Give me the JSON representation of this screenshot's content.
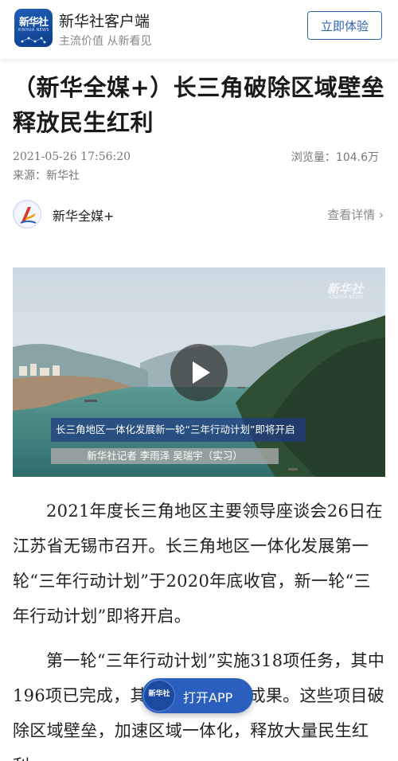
{
  "app_bar": {
    "logo_text": "新华社",
    "logo_sub": "XINHUA NEWS",
    "app_name": "新华社客户端",
    "slogan": "主流价值 从新看见",
    "cta_label": "立即体验"
  },
  "article": {
    "title": "（新华全媒+）长三角破除区域壁垒 释放民生红利",
    "datetime": "2021-05-26 17:56:20",
    "views": "浏览量：104.6万",
    "source": "来源：新华社"
  },
  "channel": {
    "name": "新华全媒+",
    "more_label": "查看详情 ›"
  },
  "video": {
    "watermark": "新华社",
    "watermark_sub": "XINHUA NEWS",
    "caption_title": "长三角地区一体化发展新一轮“三年行动计划”即将开启",
    "caption_credit": "新华社记者 李雨泽 吴瑞宇（实习）"
  },
  "body": {
    "paragraphs": [
      "2021年度长三角地区主要领导座谈会26日在江苏省无锡市召开。长三角地区一体化发展第一轮“三年行动计划”于2020年底收官，新一轮“三年行动计划”即将开启。",
      "第一轮“三年行动计划”实施318项任务，其中196项已完成，其余取得阶段性成果。这些项目破除区域壁垒，加速区域一体化，释放大量民生红利。"
    ]
  },
  "floating": {
    "logo_text": "新华社",
    "label": "打开APP"
  },
  "icons": {
    "app_logo": "xinhua-logo-icon",
    "channel_avatar": "xinhua-allmedia-icon",
    "play": "play-icon"
  },
  "colors": {
    "brand_blue": "#2b5fbd",
    "caption_bg": "#1e3c82"
  }
}
